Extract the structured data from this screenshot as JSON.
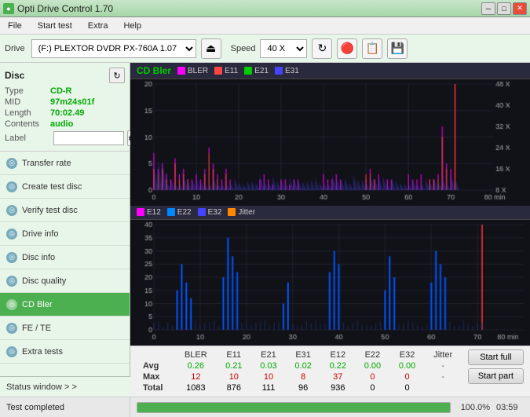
{
  "titlebar": {
    "icon": "●",
    "title": "Opti Drive Control 1.70",
    "minimize": "─",
    "maximize": "□",
    "close": "✕"
  },
  "menu": {
    "items": [
      "File",
      "Start test",
      "Extra",
      "Help"
    ]
  },
  "toolbar": {
    "drive_label": "Drive",
    "drive_value": "(F:)  PLEXTOR DVDR  PX-760A 1.07",
    "eject_icon": "⏏",
    "speed_label": "Speed",
    "speed_value": "40 X",
    "refresh_icon": "↻",
    "erase_icon": "◻",
    "copy_icon": "⎘",
    "save_icon": "💾"
  },
  "sidebar": {
    "disc": {
      "title": "Disc",
      "refresh_icon": "↻",
      "rows": [
        {
          "label": "Type",
          "value": "CD-R"
        },
        {
          "label": "MID",
          "value": "97m24s01f"
        },
        {
          "label": "Length",
          "value": "70:02.49"
        },
        {
          "label": "Contents",
          "value": "audio"
        },
        {
          "label": "Label",
          "value": ""
        }
      ]
    },
    "nav": [
      {
        "id": "transfer-rate",
        "label": "Transfer rate",
        "active": false
      },
      {
        "id": "create-test-disc",
        "label": "Create test disc",
        "active": false
      },
      {
        "id": "verify-test-disc",
        "label": "Verify test disc",
        "active": false
      },
      {
        "id": "drive-info",
        "label": "Drive info",
        "active": false
      },
      {
        "id": "disc-info",
        "label": "Disc info",
        "active": false
      },
      {
        "id": "disc-quality",
        "label": "Disc quality",
        "active": false
      },
      {
        "id": "cd-bler",
        "label": "CD Bler",
        "active": true
      },
      {
        "id": "fe-te",
        "label": "FE / TE",
        "active": false
      },
      {
        "id": "extra-tests",
        "label": "Extra tests",
        "active": false
      }
    ],
    "status_window": "Status window > >"
  },
  "chart1": {
    "title": "CD Bler",
    "legend": [
      {
        "label": "BLER",
        "color": "#ff00ff"
      },
      {
        "label": "E11",
        "color": "#ff4444"
      },
      {
        "label": "E21",
        "color": "#00cc00"
      },
      {
        "label": "E31",
        "color": "#4444ff"
      }
    ],
    "y_max": 20,
    "y_label": "X",
    "right_labels": [
      "48 X",
      "40 X",
      "32 X",
      "24 X",
      "16 X",
      "8 X"
    ]
  },
  "chart2": {
    "legend": [
      {
        "label": "E12",
        "color": "#ff00ff"
      },
      {
        "label": "E22",
        "color": "#0088ff"
      },
      {
        "label": "E32",
        "color": "#4444ff"
      },
      {
        "label": "Jitter",
        "color": "#ff8800"
      }
    ],
    "y_max": 40
  },
  "stats": {
    "columns": [
      "",
      "BLER",
      "E11",
      "E21",
      "E31",
      "E12",
      "E22",
      "E32",
      "Jitter"
    ],
    "rows": [
      {
        "label": "Avg",
        "values": [
          "0.26",
          "0.21",
          "0.03",
          "0.02",
          "0.22",
          "0.00",
          "0.00",
          "-"
        ],
        "color": "green"
      },
      {
        "label": "Max",
        "values": [
          "12",
          "10",
          "10",
          "8",
          "37",
          "0",
          "0",
          "-"
        ],
        "color": "red"
      },
      {
        "label": "Total",
        "values": [
          "1083",
          "876",
          "111",
          "96",
          "936",
          "0",
          "0",
          ""
        ],
        "color": "normal"
      }
    ],
    "buttons": {
      "start_full": "Start full",
      "start_part": "Start part"
    }
  },
  "status": {
    "text": "Test completed",
    "progress": 100.0,
    "progress_text": "100.0%",
    "time": "03:59"
  },
  "colors": {
    "green": "#4caf50",
    "sidebar_bg": "#e8f5e9",
    "chart_bg": "#111118",
    "active_nav": "#4caf50"
  }
}
